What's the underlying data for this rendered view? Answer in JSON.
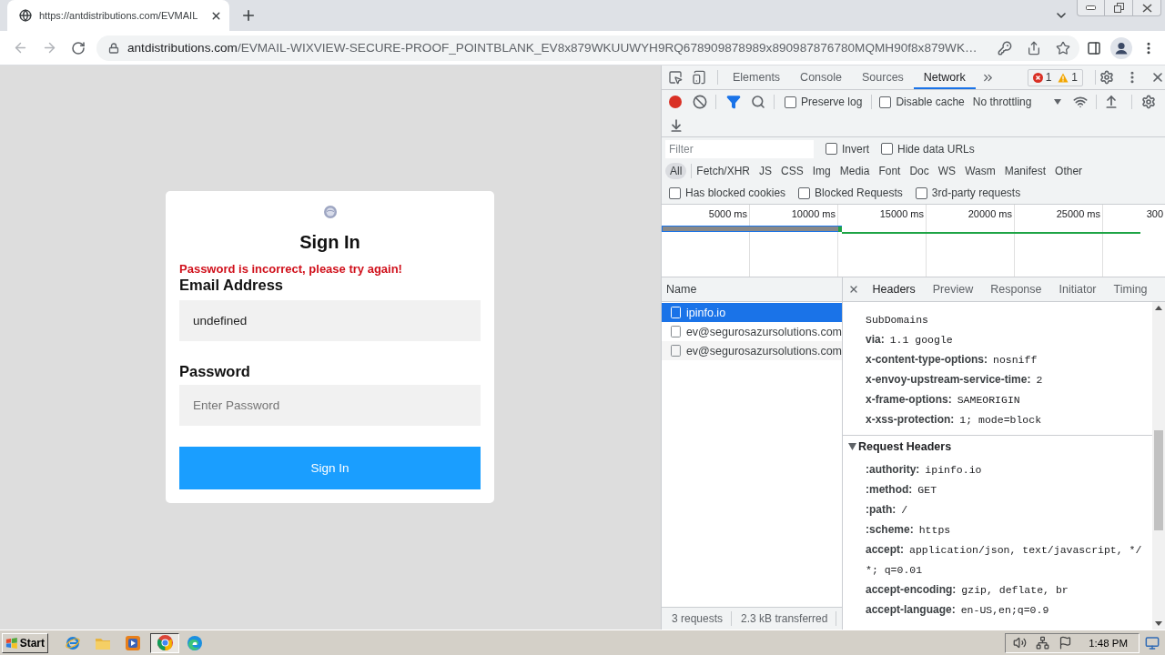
{
  "browser": {
    "tabs": [
      {
        "title": "https://antdistributions.com/EVMAIL",
        "selected": true
      }
    ],
    "address": {
      "host": "antdistributions.com",
      "path": "/EVMAIL-WIXVIEW-SECURE-PROOF_POINTBLANK_EV8x879WKUUWYH9RQ678909878989x890987876780MQMH90f8x879WK…"
    }
  },
  "page": {
    "title": "Sign In",
    "error": "Password is incorrect, please try again!",
    "fields": [
      {
        "label": "Email Address",
        "value": "undefined"
      },
      {
        "label": "Password",
        "placeholder": "Enter Password"
      }
    ],
    "submit": "Sign In"
  },
  "devtools": {
    "tabs": [
      {
        "label": "Elements",
        "selected": false
      },
      {
        "label": "Console",
        "selected": false
      },
      {
        "label": "Sources",
        "selected": false
      },
      {
        "label": "Network",
        "selected": true
      }
    ],
    "issues": {
      "errors": "1",
      "warnings": "1"
    },
    "recording": true,
    "options": [
      {
        "label": "Preserve log",
        "checked": false
      },
      {
        "label": "Disable cache",
        "checked": false
      }
    ],
    "throttling": "No throttling",
    "filter": {
      "placeholder": "Filter",
      "options": [
        {
          "label": "Invert",
          "checked": false
        },
        {
          "label": "Hide data URLs",
          "checked": false
        }
      ]
    },
    "types": [
      {
        "label": "All",
        "selected": true
      },
      {
        "label": "Fetch/XHR",
        "selected": false
      },
      {
        "label": "JS",
        "selected": false
      },
      {
        "label": "CSS",
        "selected": false
      },
      {
        "label": "Img",
        "selected": false
      },
      {
        "label": "Media",
        "selected": false
      },
      {
        "label": "Font",
        "selected": false
      },
      {
        "label": "Doc",
        "selected": false
      },
      {
        "label": "WS",
        "selected": false
      },
      {
        "label": "Wasm",
        "selected": false
      },
      {
        "label": "Manifest",
        "selected": false
      },
      {
        "label": "Other",
        "selected": false
      }
    ],
    "blocking": [
      {
        "label": "Has blocked cookies",
        "checked": false
      },
      {
        "label": "Blocked Requests",
        "checked": false
      },
      {
        "label": "3rd-party requests",
        "checked": false
      }
    ],
    "overview": {
      "ticks": [
        "5000 ms",
        "10000 ms",
        "15000 ms",
        "20000 ms",
        "25000 ms",
        "300"
      ]
    },
    "requests": {
      "column": "Name",
      "rows": [
        {
          "name": "ipinfo.io",
          "selected": true
        },
        {
          "name": "ev@segurosazursolutions.com",
          "selected": false
        },
        {
          "name": "ev@segurosazursolutions.com",
          "selected": false
        }
      ]
    },
    "summary": [
      "3 requests",
      "2.3 kB transferred"
    ],
    "detail_tabs": [
      {
        "label": "Headers",
        "selected": true
      },
      {
        "label": "Preview",
        "selected": false
      },
      {
        "label": "Response",
        "selected": false
      },
      {
        "label": "Initiator",
        "selected": false
      },
      {
        "label": "Timing",
        "selected": false
      }
    ],
    "response_headers": [
      {
        "kind": "continuation",
        "value": "SubDomains"
      },
      {
        "kind": "header",
        "name": "via:",
        "value": "1.1 google"
      },
      {
        "kind": "header",
        "name": "x-content-type-options:",
        "value": "nosniff"
      },
      {
        "kind": "header",
        "name": "x-envoy-upstream-service-time:",
        "value": "2"
      },
      {
        "kind": "header",
        "name": "x-frame-options:",
        "value": "SAMEORIGIN"
      },
      {
        "kind": "header",
        "name": "x-xss-protection:",
        "value": "1; mode=block"
      }
    ],
    "request_headers": {
      "title": "Request Headers",
      "expanded": true,
      "rows": [
        {
          "kind": "header",
          "name": ":authority:",
          "value": "ipinfo.io"
        },
        {
          "kind": "header",
          "name": ":method:",
          "value": "GET"
        },
        {
          "kind": "header",
          "name": ":path:",
          "value": "/"
        },
        {
          "kind": "header",
          "name": ":scheme:",
          "value": "https"
        },
        {
          "kind": "header",
          "name": "accept:",
          "value": "application/json, text/javascript, */"
        },
        {
          "kind": "continuation",
          "value": "*; q=0.01"
        },
        {
          "kind": "header",
          "name": "accept-encoding:",
          "value": "gzip, deflate, br"
        },
        {
          "kind": "header",
          "name": "accept-language:",
          "value": "en-US,en;q=0.9"
        }
      ]
    }
  },
  "taskbar": {
    "start": "Start",
    "clock": "1:48 PM"
  }
}
